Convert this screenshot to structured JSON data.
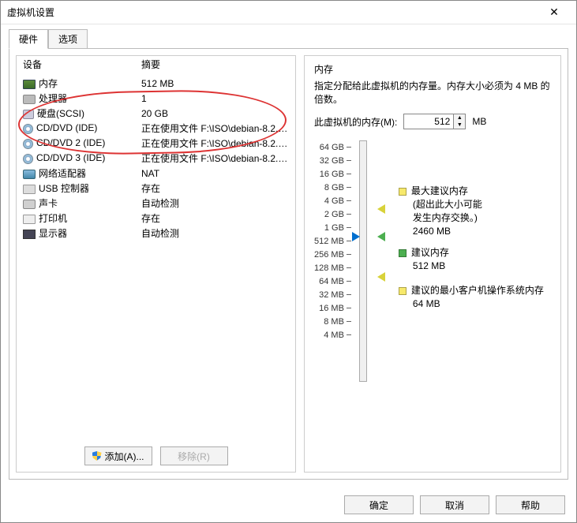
{
  "window": {
    "title": "虚拟机设置"
  },
  "tabs": {
    "hardware": "硬件",
    "options": "选项"
  },
  "left": {
    "headers": {
      "device": "设备",
      "summary": "摘要"
    },
    "devices": [
      {
        "icon": "mem",
        "name": "内存",
        "summary": "512 MB"
      },
      {
        "icon": "cpu",
        "name": "处理器",
        "summary": "1"
      },
      {
        "icon": "hdd",
        "name": "硬盘(SCSI)",
        "summary": "20 GB"
      },
      {
        "icon": "cd",
        "name": "CD/DVD (IDE)",
        "summary": "正在使用文件 F:\\ISO\\debian-8.2.0-a..."
      },
      {
        "icon": "cd",
        "name": "CD/DVD 2 (IDE)",
        "summary": "正在使用文件 F:\\ISO\\debian-8.2.0-a..."
      },
      {
        "icon": "cd",
        "name": "CD/DVD 3 (IDE)",
        "summary": "正在使用文件 F:\\ISO\\debian-8.2.0-a..."
      },
      {
        "icon": "net",
        "name": "网络适配器",
        "summary": "NAT"
      },
      {
        "icon": "usb",
        "name": "USB 控制器",
        "summary": "存在"
      },
      {
        "icon": "snd",
        "name": "声卡",
        "summary": "自动检测"
      },
      {
        "icon": "prn",
        "name": "打印机",
        "summary": "存在"
      },
      {
        "icon": "disp",
        "name": "显示器",
        "summary": "自动检测"
      }
    ],
    "buttons": {
      "add": "添加(A)...",
      "remove": "移除(R)"
    }
  },
  "right": {
    "title": "内存",
    "desc": "指定分配给此虚拟机的内存量。内存大小必须为 4 MB 的倍数。",
    "mem_label": "此虚拟机的内存(M):",
    "mem_value": "512",
    "mem_unit": "MB",
    "ticks": [
      "64 GB",
      "32 GB",
      "16 GB",
      "8 GB",
      "4 GB",
      "2 GB",
      "1 GB",
      "512 MB",
      "256 MB",
      "128 MB",
      "64 MB",
      "32 MB",
      "16 MB",
      "8 MB",
      "4 MB"
    ],
    "legend": {
      "max": {
        "label": "最大建议内存",
        "note1": "(超出此大小可能",
        "note2": "发生内存交换。)",
        "value": "2460 MB",
        "color": "#f7e96b"
      },
      "rec": {
        "label": "建议内存",
        "value": "512 MB",
        "color": "#4caf50"
      },
      "min": {
        "label": "建议的最小客户机操作系统内存",
        "value": "64 MB",
        "color": "#f7e96b"
      }
    }
  },
  "footer": {
    "ok": "确定",
    "cancel": "取消",
    "help": "帮助"
  }
}
